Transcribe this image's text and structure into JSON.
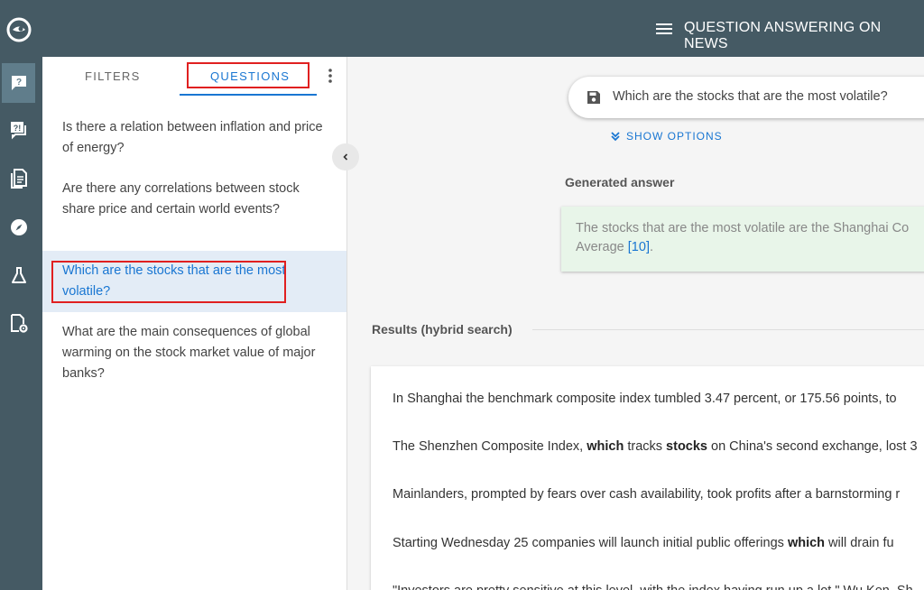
{
  "app": {
    "title": "QUESTION ANSWERING ON NEWS"
  },
  "rail": {
    "icons": [
      "logo-icon",
      "question-icon",
      "faq-icon",
      "document-icon",
      "compass-icon",
      "flask-icon",
      "file-settings-icon"
    ],
    "active_index": 0
  },
  "tabs": {
    "filters": "FILTERS",
    "questions": "QUESTIONS"
  },
  "questions": [
    "Is there a relation between inflation and price of energy?",
    "Are there any correlations between stock share price and certain world events?",
    "Which are the stocks that are the most volatile?",
    "What are the main consequences of global warming on the stock market value of major banks?"
  ],
  "selected_question_index": 2,
  "search": {
    "query": "Which are the stocks that are the most volatile?"
  },
  "show_options": "SHOW OPTIONS",
  "generated": {
    "label": "Generated answer",
    "text_part1": "The stocks that are the most volatile are the Shanghai Co",
    "text_part2": "Average",
    "ref": "[10]",
    "end": "."
  },
  "results": {
    "label": "Results (hybrid search)",
    "lines": [
      {
        "parts": [
          {
            "t": "In Shanghai the benchmark composite index tumbled 3.47 percent, or 175.56 points, to ",
            "b": false
          }
        ]
      },
      {
        "parts": [
          {
            "t": "The Shenzhen Composite Index, ",
            "b": false
          },
          {
            "t": "which",
            "b": true
          },
          {
            "t": " tracks ",
            "b": false
          },
          {
            "t": "stocks",
            "b": true
          },
          {
            "t": " on China's second exchange, lost 3",
            "b": false
          }
        ]
      },
      {
        "parts": [
          {
            "t": "Mainlanders, prompted by fears over cash availability, took profits after a barnstorming r",
            "b": false
          }
        ]
      },
      {
        "parts": [
          {
            "t": "Starting Wednesday 25 companies will launch initial public offerings  ",
            "b": false
          },
          {
            "t": "which",
            "b": true
          },
          {
            "t": " will drain fu",
            "b": false
          }
        ]
      },
      {
        "parts": [
          {
            "t": "\"Investors are pretty sensitive at this level, with the index having run up a lot,\" Wu Ken, Sh",
            "b": false
          }
        ]
      }
    ]
  },
  "colors": {
    "primary": "#1976d2",
    "header": "#455a64",
    "highlight": "#e02020",
    "answer_bg": "#e8f5e9",
    "selected_bg": "#e3ecf6"
  }
}
